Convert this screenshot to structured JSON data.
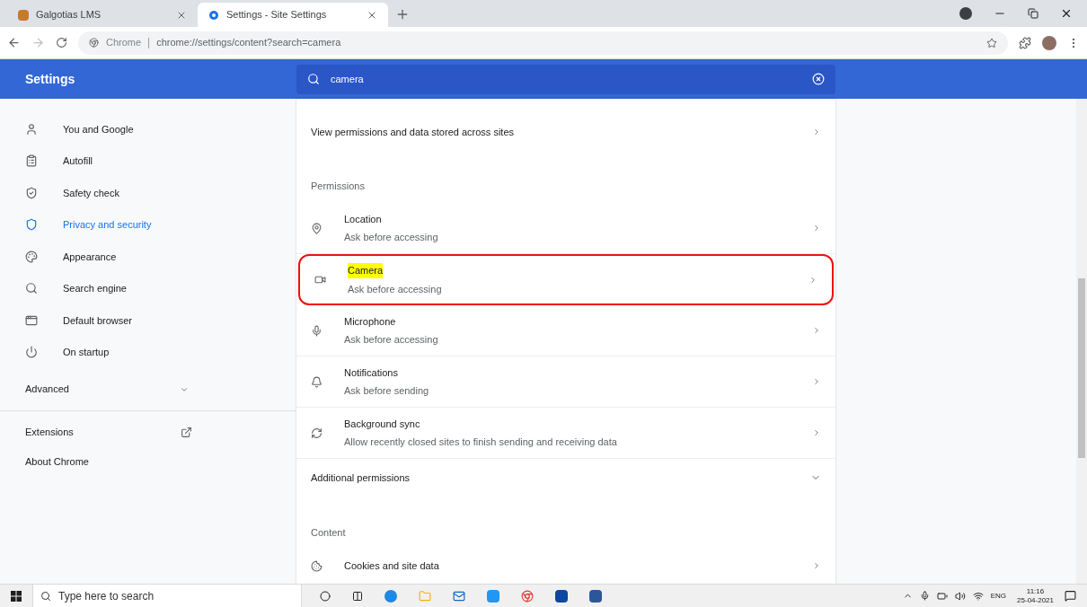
{
  "tabs": [
    {
      "title": "Galgotias LMS",
      "selected": false
    },
    {
      "title": "Settings - Site Settings",
      "selected": true
    }
  ],
  "address": {
    "origin": "Chrome",
    "url": "chrome://settings/content?search=camera"
  },
  "header": {
    "title": "Settings",
    "search": "camera"
  },
  "sidebar": {
    "items": [
      {
        "label": "You and Google",
        "selected": false
      },
      {
        "label": "Autofill",
        "selected": false
      },
      {
        "label": "Safety check",
        "selected": false
      },
      {
        "label": "Privacy and security",
        "selected": true
      },
      {
        "label": "Appearance",
        "selected": false
      },
      {
        "label": "Search engine",
        "selected": false
      },
      {
        "label": "Default browser",
        "selected": false
      },
      {
        "label": "On startup",
        "selected": false
      }
    ],
    "advanced": {
      "label": "Advanced",
      "expanded": false
    },
    "extensions": "Extensions",
    "about": "About Chrome"
  },
  "content": {
    "view_all": "View permissions and data stored across sites",
    "permissions_heading": "Permissions",
    "permissions": [
      {
        "title": "Location",
        "subtitle": "Ask before accessing",
        "highlighted": false,
        "outlined": false
      },
      {
        "title": "Camera",
        "subtitle": "Ask before accessing",
        "highlighted": true,
        "outlined": true
      },
      {
        "title": "Microphone",
        "subtitle": "Ask before accessing",
        "highlighted": false,
        "outlined": false
      },
      {
        "title": "Notifications",
        "subtitle": "Ask before sending",
        "highlighted": false,
        "outlined": false
      },
      {
        "title": "Background sync",
        "subtitle": "Allow recently closed sites to finish sending and receiving data",
        "highlighted": false,
        "outlined": false
      }
    ],
    "additional": {
      "label": "Additional permissions",
      "expanded": false
    },
    "content_heading": "Content",
    "cookies": {
      "title": "Cookies and site data"
    }
  },
  "taskbar": {
    "search_placeholder": "Type here to search",
    "language": "ENG",
    "time": "11:16",
    "date": "25-04-2021"
  }
}
